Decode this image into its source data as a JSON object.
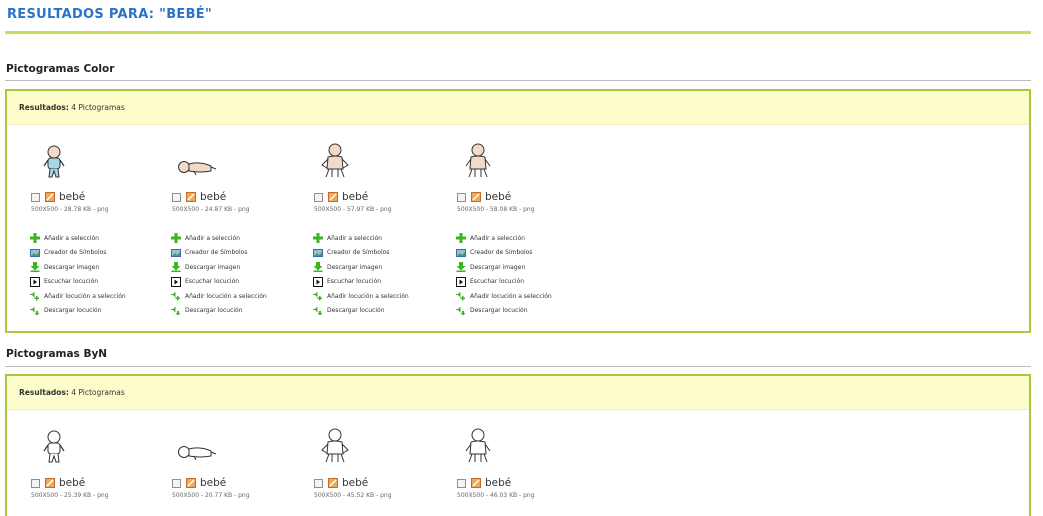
{
  "page": {
    "title": "RESULTADOS PARA: \"BEBÉ\""
  },
  "sections": [
    {
      "title": "Pictogramas Color",
      "results_label": "Resultados:",
      "results_count": "4 Pictogramas",
      "items": [
        {
          "name": "bebé",
          "meta": "500X500 - 28.78 KB - png",
          "icon": "baby-standing-color-icon"
        },
        {
          "name": "bebé",
          "meta": "500X500 - 24.87 KB - png",
          "icon": "baby-lying-color-icon"
        },
        {
          "name": "bebé",
          "meta": "500X500 - 57.97 KB - png",
          "icon": "baby-sitting-color-icon"
        },
        {
          "name": "bebé",
          "meta": "500X500 - 58.08 KB - png",
          "icon": "baby-sitting-color-icon"
        }
      ]
    },
    {
      "title": "Pictogramas ByN",
      "results_label": "Resultados:",
      "results_count": "4 Pictogramas",
      "items": [
        {
          "name": "bebé",
          "meta": "500X500 - 25.39 KB - png",
          "icon": "baby-standing-bw-icon"
        },
        {
          "name": "bebé",
          "meta": "500X500 - 20.77 KB - png",
          "icon": "baby-lying-bw-icon"
        },
        {
          "name": "bebé",
          "meta": "500X500 - 45.52 KB - png",
          "icon": "baby-sitting-bw-icon"
        },
        {
          "name": "bebé",
          "meta": "500X500 - 46.03 KB - png",
          "icon": "baby-sitting-bw-icon"
        }
      ]
    }
  ],
  "actions": [
    {
      "label": "Añadir a selección",
      "icon": "plus-green-icon"
    },
    {
      "label": "Creador de Símbolos",
      "icon": "image-editor-icon"
    },
    {
      "label": "Descargar imagen",
      "icon": "download-arrow-icon"
    },
    {
      "label": "Escuchar locución",
      "icon": "play-icon"
    },
    {
      "label": "Añadir locución a selección",
      "icon": "speaker-plus-icon"
    },
    {
      "label": "Descargar locución",
      "icon": "speaker-download-icon"
    }
  ],
  "colors": {
    "title": "#2a73c9",
    "accent_rule": "#c7e05a",
    "box_border": "#a9c83a",
    "bar_bg": "#fdfdcc"
  }
}
